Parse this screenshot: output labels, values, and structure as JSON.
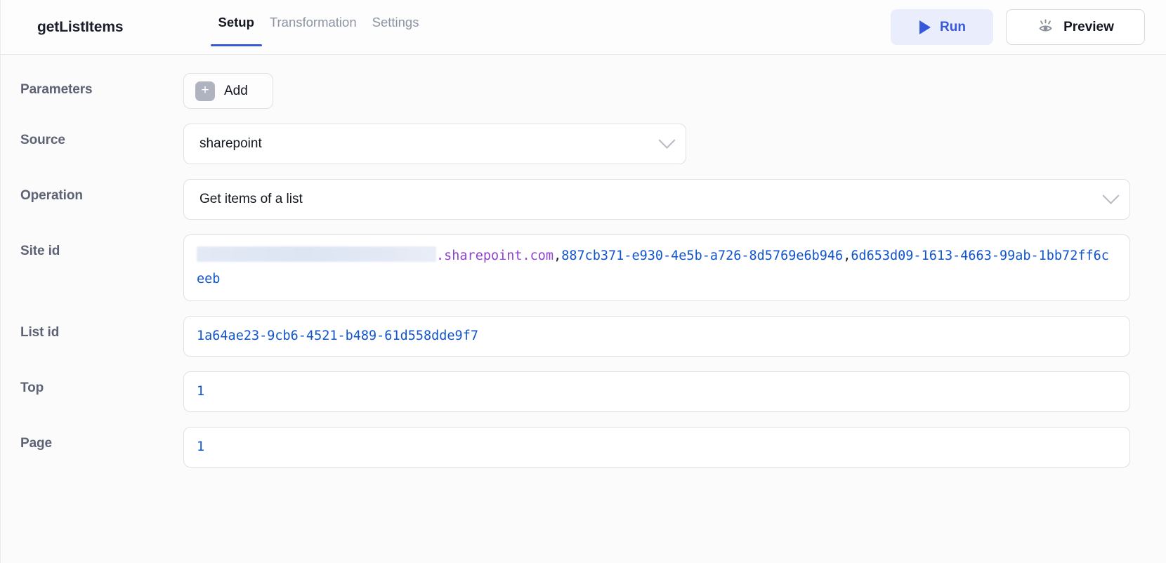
{
  "header": {
    "node_title": "getListItems",
    "tabs": [
      {
        "label": "Setup",
        "active": true
      },
      {
        "label": "Transformation",
        "active": false
      },
      {
        "label": "Settings",
        "active": false
      }
    ],
    "run_button": "Run",
    "preview_button": "Preview",
    "accent_color": "#3758db",
    "run_bg_color": "#eaeefc"
  },
  "form": {
    "parameters": {
      "label": "Parameters",
      "add_label": "Add"
    },
    "source": {
      "label": "Source",
      "value": "sharepoint"
    },
    "operation": {
      "label": "Operation",
      "value": "Get items of a list"
    },
    "site_id": {
      "label": "Site id",
      "redacted_prefix": "",
      "domain_suffix": ".sharepoint.com",
      "separator": ",",
      "guid_1": "887cb371-e930-4e5b-a726-8d5769e6b946",
      "guid_2": "6d653d09-1613-4663-99ab-1bb72ff6ceeb"
    },
    "list_id": {
      "label": "List id",
      "value": "1a64ae23-9cb6-4521-b489-61d558dde9f7"
    },
    "top": {
      "label": "Top",
      "value": "1"
    },
    "page": {
      "label": "Page",
      "value": "1"
    }
  }
}
